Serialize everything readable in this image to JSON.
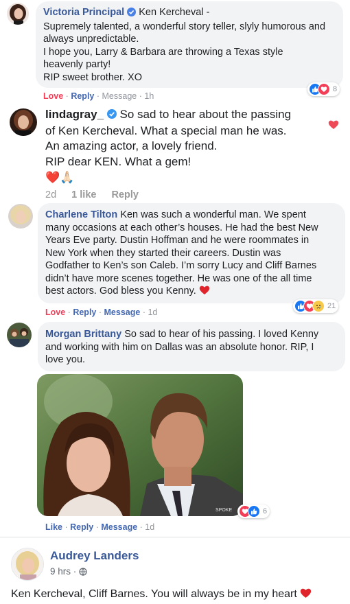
{
  "colors": {
    "link": "#385898",
    "love": "#f33e58",
    "like": "#1877f2",
    "muted": "#90949c",
    "bubble": "#f2f3f5"
  },
  "c1": {
    "name": "Victoria Principal",
    "verified_icon": "verified-badge-icon",
    "lines": [
      "Ken Kercheval -",
      "Supremely talented, a wonderful story teller, slyly humorous and",
      "always unpredictable.",
      "I hope you, Larry & Barbara are throwing a Texas style",
      "heavenly party!",
      "RIP sweet brother. XO"
    ],
    "love": "Love",
    "reply": "Reply",
    "message": "Message",
    "sep": "·",
    "time": "1h",
    "reaction_count": "8"
  },
  "c2": {
    "name": "lindagray_",
    "lines": [
      "So sad to hear about the passing",
      "of Ken Kercheval. What a special man he was.",
      "An amazing actor, a lovely friend.",
      "RIP dear KEN. What a gem!"
    ],
    "emojis": "❤️🙏🏻",
    "time": "2d",
    "likes": "1 like",
    "reply": "Reply"
  },
  "c3": {
    "name": "Charlene Tilton",
    "lines": [
      "Ken was such a wonderful man. We spent",
      "many occasions at each other’s houses. He had the best New",
      "Years Eve party. Dustin Hoffman and he were roommates in",
      "New York when they started their careers. Dustin was",
      "Godfather to Ken’s son Caleb. I’m sorry Lucy and Cliff Barnes",
      "didn’t have more scenes together. He was one of the all time",
      "best actors. God bless you Kenny."
    ],
    "love": "Love",
    "reply": "Reply",
    "message": "Message",
    "sep": "·",
    "time": "1d",
    "reaction_count": "21"
  },
  "c4": {
    "name": "Morgan Brittany",
    "lines": [
      "So sad to hear of his passing. I loved Kenny",
      "and working with him on Dallas was an absolute honor. RIP, I",
      "love you."
    ],
    "photo_watermark": "SPOKE",
    "like": "Like",
    "reply": "Reply",
    "message": "Message",
    "sep": "·",
    "time": "1d",
    "reaction_count": "6"
  },
  "c5": {
    "name": "Audrey Landers",
    "time": "9 hrs",
    "privacy_icon": "globe-icon",
    "text": "Ken Kercheval, Cliff Barnes. You will always be in my heart"
  }
}
